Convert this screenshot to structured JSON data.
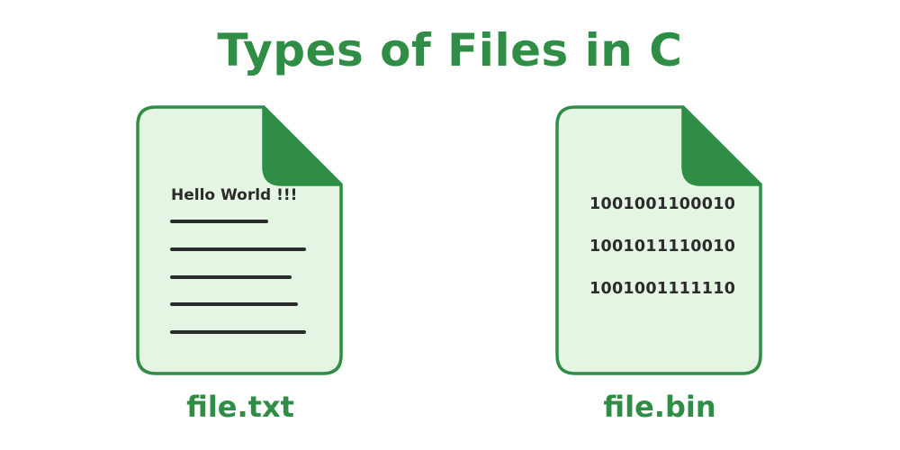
{
  "title": "Types of Files in C",
  "colors": {
    "accent": "#2f8d46",
    "doc_fill": "#e5f5e3",
    "text_dark": "#2b2b2b"
  },
  "text_file": {
    "icon": "text-document-icon",
    "content_heading": "Hello World !!!",
    "line_count": 5,
    "name": "file.txt"
  },
  "binary_file": {
    "icon": "binary-document-icon",
    "lines": [
      "1001001100010",
      "1001011110010",
      "1001001111110"
    ],
    "name": "file.bin"
  }
}
